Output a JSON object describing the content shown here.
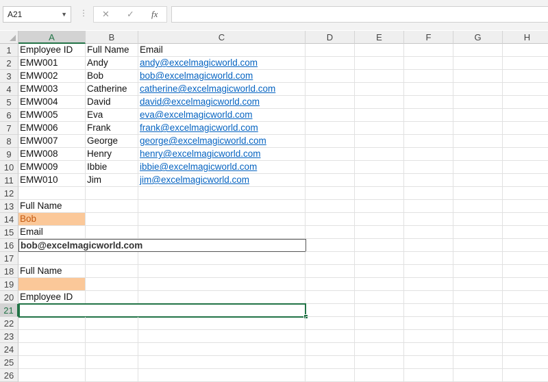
{
  "formula_bar": {
    "name_box": "A21",
    "fx_label": "fx",
    "cancel_glyph": "✕",
    "enter_glyph": "✓",
    "formula": ""
  },
  "columns": [
    "A",
    "B",
    "C",
    "D",
    "E",
    "F",
    "G",
    "H"
  ],
  "selected_cell": "A21",
  "rows": [
    {
      "n": "1",
      "a": "Employee ID",
      "b": "Full Name",
      "c": "Email"
    },
    {
      "n": "2",
      "a": "EMW001",
      "b": "Andy",
      "c": "andy@excelmagicworld.com"
    },
    {
      "n": "3",
      "a": "EMW002",
      "b": "Bob",
      "c": "bob@excelmagicworld.com"
    },
    {
      "n": "4",
      "a": "EMW003",
      "b": "Catherine",
      "c": "catherine@excelmagicworld.com"
    },
    {
      "n": "5",
      "a": "EMW004",
      "b": "David",
      "c": "david@excelmagicworld.com"
    },
    {
      "n": "6",
      "a": "EMW005",
      "b": "Eva",
      "c": "eva@excelmagicworld.com"
    },
    {
      "n": "7",
      "a": "EMW006",
      "b": "Frank",
      "c": "frank@excelmagicworld.com"
    },
    {
      "n": "8",
      "a": "EMW007",
      "b": "George",
      "c": "george@excelmagicworld.com"
    },
    {
      "n": "9",
      "a": "EMW008",
      "b": "Henry",
      "c": "henry@excelmagicworld.com"
    },
    {
      "n": "10",
      "a": "EMW009",
      "b": "Ibbie",
      "c": "ibbie@excelmagicworld.com"
    },
    {
      "n": "11",
      "a": "EMW010",
      "b": "Jim",
      "c": "jim@excelmagicworld.com"
    },
    {
      "n": "12",
      "a": "",
      "b": "",
      "c": ""
    },
    {
      "n": "13",
      "a": "Full Name",
      "b": "",
      "c": ""
    },
    {
      "n": "14",
      "a": "Bob",
      "b": "",
      "c": ""
    },
    {
      "n": "15",
      "a": "Email",
      "b": "",
      "c": ""
    },
    {
      "n": "16",
      "a": "bob@excelmagicworld.com",
      "b": "",
      "c": ""
    },
    {
      "n": "17",
      "a": "",
      "b": "",
      "c": ""
    },
    {
      "n": "18",
      "a": "Full Name",
      "b": "",
      "c": ""
    },
    {
      "n": "19",
      "a": "",
      "b": "",
      "c": ""
    },
    {
      "n": "20",
      "a": "Employee ID",
      "b": "",
      "c": ""
    },
    {
      "n": "21",
      "a": "",
      "b": "",
      "c": ""
    },
    {
      "n": "22",
      "a": "",
      "b": "",
      "c": ""
    },
    {
      "n": "23",
      "a": "",
      "b": "",
      "c": ""
    },
    {
      "n": "24",
      "a": "",
      "b": "",
      "c": ""
    },
    {
      "n": "25",
      "a": "",
      "b": "",
      "c": ""
    },
    {
      "n": "26",
      "a": "",
      "b": "",
      "c": ""
    }
  ],
  "colors": {
    "accent": "#217346",
    "link": "#0563c1",
    "input_fill": "#fbc899"
  }
}
